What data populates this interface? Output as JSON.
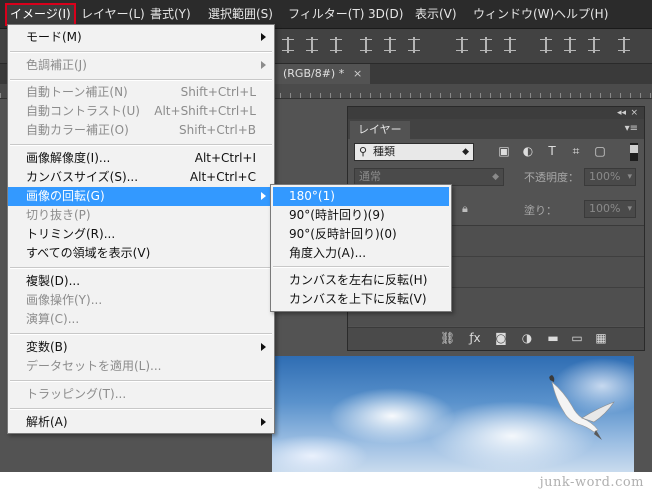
{
  "menubar": {
    "items": [
      "イメージ(I)",
      "レイヤー(L)",
      "書式(Y)",
      "選択範囲(S)",
      "フィルター(T)",
      "3D(D)",
      "表示(V)",
      "ウィンドウ(W)",
      "ヘルプ(H)"
    ]
  },
  "document_tab": {
    "title": "(RGB/8#) *",
    "close": "×"
  },
  "image_menu": {
    "items": [
      {
        "label": "モード(M)",
        "shortcut": "",
        "submenu": true,
        "enabled": true
      },
      {
        "label": "色調補正(J)",
        "shortcut": "",
        "submenu": true,
        "enabled": false
      },
      {
        "label": "自動トーン補正(N)",
        "shortcut": "Shift+Ctrl+L",
        "submenu": false,
        "enabled": false
      },
      {
        "label": "自動コントラスト(U)",
        "shortcut": "Alt+Shift+Ctrl+L",
        "submenu": false,
        "enabled": false
      },
      {
        "label": "自動カラー補正(O)",
        "shortcut": "Shift+Ctrl+B",
        "submenu": false,
        "enabled": false
      },
      {
        "label": "画像解像度(I)...",
        "shortcut": "Alt+Ctrl+I",
        "submenu": false,
        "enabled": true
      },
      {
        "label": "カンバスサイズ(S)...",
        "shortcut": "Alt+Ctrl+C",
        "submenu": false,
        "enabled": true
      },
      {
        "label": "画像の回転(G)",
        "shortcut": "",
        "submenu": true,
        "enabled": true,
        "highlighted": true
      },
      {
        "label": "切り抜き(P)",
        "shortcut": "",
        "submenu": false,
        "enabled": false
      },
      {
        "label": "トリミング(R)...",
        "shortcut": "",
        "submenu": false,
        "enabled": true
      },
      {
        "label": "すべての領域を表示(V)",
        "shortcut": "",
        "submenu": false,
        "enabled": true
      },
      {
        "label": "複製(D)...",
        "shortcut": "",
        "submenu": false,
        "enabled": true
      },
      {
        "label": "画像操作(Y)...",
        "shortcut": "",
        "submenu": false,
        "enabled": false
      },
      {
        "label": "演算(C)...",
        "shortcut": "",
        "submenu": false,
        "enabled": false
      },
      {
        "label": "変数(B)",
        "shortcut": "",
        "submenu": true,
        "enabled": true
      },
      {
        "label": "データセットを適用(L)...",
        "shortcut": "",
        "submenu": false,
        "enabled": false
      },
      {
        "label": "トラッピング(T)...",
        "shortcut": "",
        "submenu": false,
        "enabled": false
      },
      {
        "label": "解析(A)",
        "shortcut": "",
        "submenu": true,
        "enabled": true
      }
    ]
  },
  "rotate_submenu": {
    "items": [
      "180°(1)",
      "90°(時計回り)(9)",
      "90°(反時計回り)(0)",
      "角度入力(A)...",
      "カンバスを左右に反転(H)",
      "カンバスを上下に反転(V)"
    ],
    "highlighted_index": 0
  },
  "layers_panel": {
    "tab_label": "レイヤー",
    "filter_label": "種類",
    "blend_mode": "通常",
    "opacity_label": "不透明度：",
    "opacity_value": "100%",
    "fill_label": "塗り：",
    "fill_value": "100%",
    "collapse_glyph": "◂◂",
    "close_glyph": "×"
  },
  "watermark": "junk-word.com",
  "colors": {
    "menu_highlight": "#3399ff",
    "active_outline": "#d9001b",
    "ui_dark": "#2b2b2b"
  }
}
